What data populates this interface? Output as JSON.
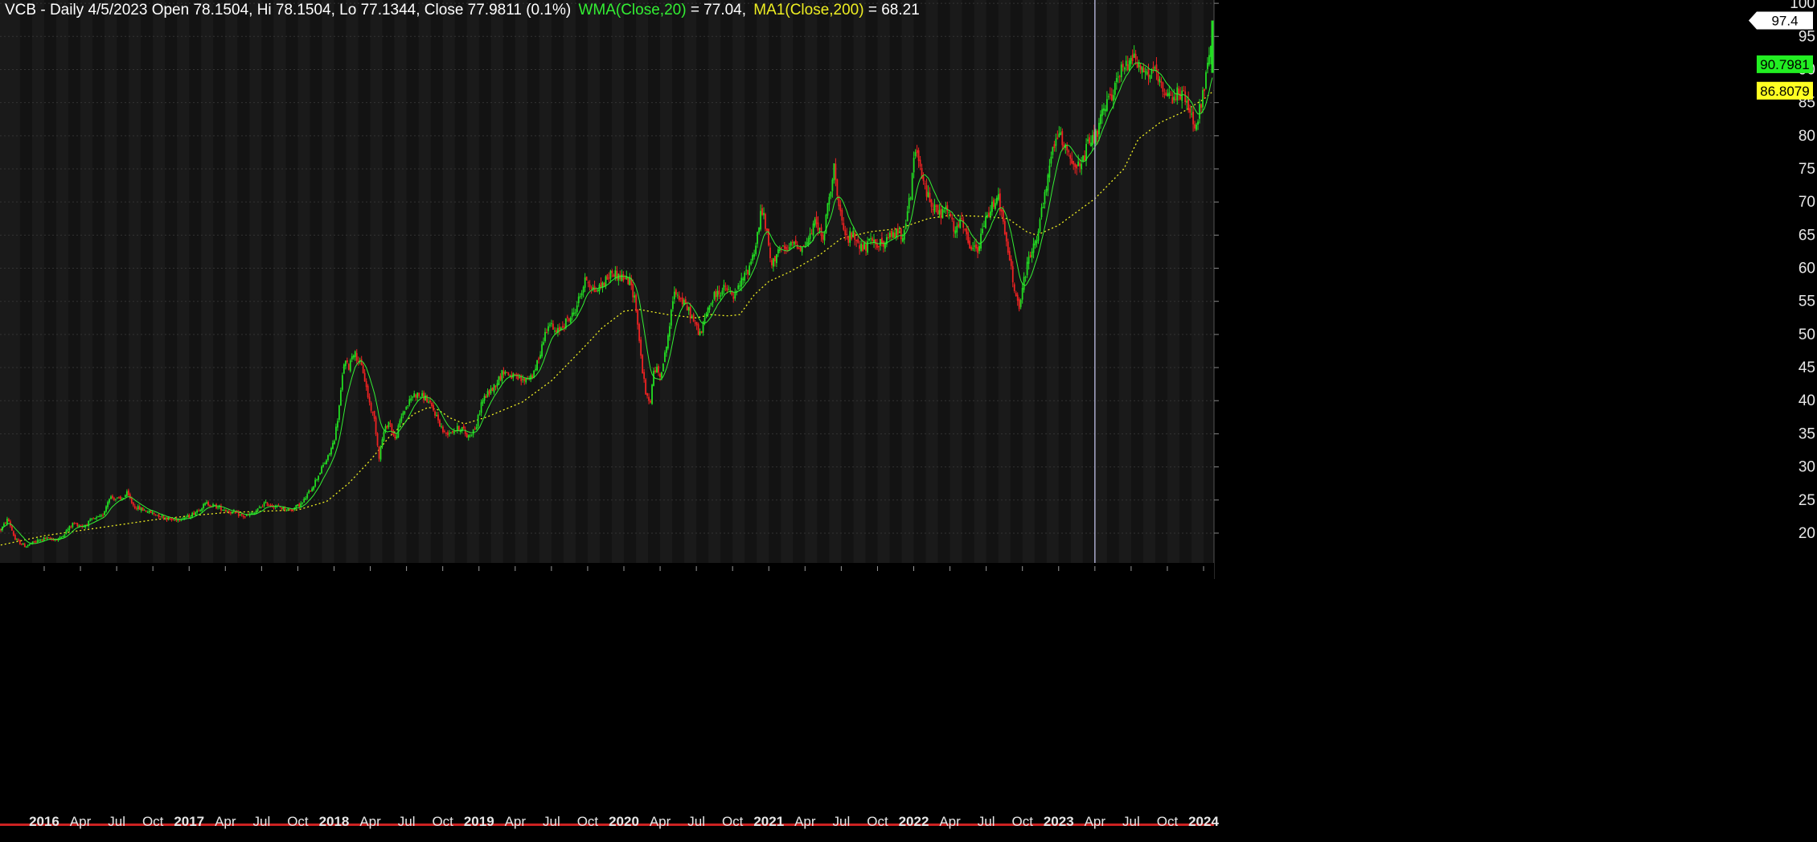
{
  "header": {
    "symbol_info": "VCB - Daily 4/5/2023 Open 78.1504, Hi 78.1504, Lo 77.1344, Close 77.9811 (0.1%)",
    "wma_label": "WMA(Close,20)",
    "wma_value": " = 77.04,",
    "ma_label": "MA1(Close,200)",
    "ma_value": " = 68.21"
  },
  "colors": {
    "background": "#1a1a1a",
    "band_alt": "#131313",
    "grid": "#333333",
    "up_candle": "#22dd22",
    "down_candle": "#ee2222",
    "wma_line": "#33ee33",
    "ma_line": "#eeee22",
    "cursor_line": "#aaaacc"
  },
  "chart_data": {
    "type": "line",
    "title": "VCB - Daily",
    "yticks": [
      20,
      25,
      30,
      35,
      40,
      45,
      50,
      55,
      60,
      65,
      70,
      75,
      80,
      85,
      90,
      95,
      100
    ],
    "ylim": [
      15.5,
      100.5
    ],
    "xticks": [
      {
        "label": "2016",
        "t": 2016.0,
        "year": true
      },
      {
        "label": "Apr",
        "t": 2016.25
      },
      {
        "label": "Jul",
        "t": 2016.5
      },
      {
        "label": "Oct",
        "t": 2016.75
      },
      {
        "label": "2017",
        "t": 2017.0,
        "year": true
      },
      {
        "label": "Apr",
        "t": 2017.25
      },
      {
        "label": "Jul",
        "t": 2017.5
      },
      {
        "label": "Oct",
        "t": 2017.75
      },
      {
        "label": "2018",
        "t": 2018.0,
        "year": true
      },
      {
        "label": "Apr",
        "t": 2018.25
      },
      {
        "label": "Jul",
        "t": 2018.5
      },
      {
        "label": "Oct",
        "t": 2018.75
      },
      {
        "label": "2019",
        "t": 2019.0,
        "year": true
      },
      {
        "label": "Apr",
        "t": 2019.25
      },
      {
        "label": "Jul",
        "t": 2019.5
      },
      {
        "label": "Oct",
        "t": 2019.75
      },
      {
        "label": "2020",
        "t": 2020.0,
        "year": true
      },
      {
        "label": "Apr",
        "t": 2020.25
      },
      {
        "label": "Jul",
        "t": 2020.5
      },
      {
        "label": "Oct",
        "t": 2020.75
      },
      {
        "label": "2021",
        "t": 2021.0,
        "year": true
      },
      {
        "label": "Apr",
        "t": 2021.25
      },
      {
        "label": "Jul",
        "t": 2021.5
      },
      {
        "label": "Oct",
        "t": 2021.75
      },
      {
        "label": "2022",
        "t": 2022.0,
        "year": true
      },
      {
        "label": "Apr",
        "t": 2022.25
      },
      {
        "label": "Jul",
        "t": 2022.5
      },
      {
        "label": "Oct",
        "t": 2022.75
      },
      {
        "label": "2023",
        "t": 2023.0,
        "year": true
      },
      {
        "label": "Apr",
        "t": 2023.25
      },
      {
        "label": "Jul",
        "t": 2023.5
      },
      {
        "label": "Oct",
        "t": 2023.75
      },
      {
        "label": "2024",
        "t": 2024.0,
        "year": true
      }
    ],
    "xrange": [
      2015.695,
      2024.072
    ],
    "price_path": [
      [
        2015.7,
        20.5
      ],
      [
        2015.75,
        22.2
      ],
      [
        2015.8,
        19.0
      ],
      [
        2015.87,
        18.0
      ],
      [
        2015.93,
        18.6
      ],
      [
        2016.0,
        19.2
      ],
      [
        2016.1,
        19.0
      ],
      [
        2016.2,
        21.5
      ],
      [
        2016.27,
        21.0
      ],
      [
        2016.33,
        22.0
      ],
      [
        2016.4,
        22.5
      ],
      [
        2016.45,
        25.5
      ],
      [
        2016.53,
        25.0
      ],
      [
        2016.57,
        26.0
      ],
      [
        2016.62,
        24.0
      ],
      [
        2016.75,
        23.0
      ],
      [
        2016.88,
        22.0
      ],
      [
        2017.0,
        22.5
      ],
      [
        2017.12,
        24.5
      ],
      [
        2017.25,
        23.5
      ],
      [
        2017.38,
        22.5
      ],
      [
        2017.45,
        23.0
      ],
      [
        2017.52,
        24.5
      ],
      [
        2017.6,
        24.0
      ],
      [
        2017.7,
        23.5
      ],
      [
        2017.78,
        24.5
      ],
      [
        2017.85,
        27.0
      ],
      [
        2017.92,
        30.0
      ],
      [
        2017.96,
        31.5
      ],
      [
        2018.0,
        34.0
      ],
      [
        2018.03,
        38.0
      ],
      [
        2018.07,
        46.0
      ],
      [
        2018.1,
        45.0
      ],
      [
        2018.13,
        47.5
      ],
      [
        2018.16,
        46.5
      ],
      [
        2018.2,
        44.5
      ],
      [
        2018.24,
        40.0
      ],
      [
        2018.28,
        37.0
      ],
      [
        2018.31,
        31.5
      ],
      [
        2018.34,
        35.0
      ],
      [
        2018.38,
        37.0
      ],
      [
        2018.42,
        34.0
      ],
      [
        2018.47,
        38.0
      ],
      [
        2018.55,
        41.0
      ],
      [
        2018.63,
        40.5
      ],
      [
        2018.7,
        38.0
      ],
      [
        2018.76,
        35.0
      ],
      [
        2018.82,
        35.5
      ],
      [
        2018.88,
        36.0
      ],
      [
        2018.92,
        34.5
      ],
      [
        2018.98,
        36.0
      ],
      [
        2019.02,
        40.0
      ],
      [
        2019.1,
        42.0
      ],
      [
        2019.17,
        44.5
      ],
      [
        2019.24,
        43.5
      ],
      [
        2019.3,
        43.0
      ],
      [
        2019.38,
        44.0
      ],
      [
        2019.43,
        48.0
      ],
      [
        2019.48,
        52.0
      ],
      [
        2019.53,
        50.0
      ],
      [
        2019.58,
        51.5
      ],
      [
        2019.65,
        53.0
      ],
      [
        2019.7,
        56.0
      ],
      [
        2019.74,
        58.5
      ],
      [
        2019.8,
        56.5
      ],
      [
        2019.85,
        57.5
      ],
      [
        2019.92,
        59.5
      ],
      [
        2019.95,
        59.0
      ],
      [
        2020.0,
        58.5
      ],
      [
        2020.04,
        58.0
      ],
      [
        2020.08,
        55.0
      ],
      [
        2020.12,
        46.0
      ],
      [
        2020.15,
        41.0
      ],
      [
        2020.18,
        39.5
      ],
      [
        2020.21,
        45.0
      ],
      [
        2020.25,
        44.0
      ],
      [
        2020.28,
        46.5
      ],
      [
        2020.32,
        52.0
      ],
      [
        2020.35,
        57.0
      ],
      [
        2020.4,
        55.0
      ],
      [
        2020.45,
        53.5
      ],
      [
        2020.5,
        51.0
      ],
      [
        2020.53,
        50.0
      ],
      [
        2020.58,
        54.0
      ],
      [
        2020.63,
        56.0
      ],
      [
        2020.7,
        57.0
      ],
      [
        2020.76,
        55.5
      ],
      [
        2020.8,
        57.5
      ],
      [
        2020.86,
        60.0
      ],
      [
        2020.91,
        63.5
      ],
      [
        2020.95,
        69.0
      ],
      [
        2020.98,
        66.0
      ],
      [
        2021.02,
        60.0
      ],
      [
        2021.06,
        63.0
      ],
      [
        2021.12,
        62.5
      ],
      [
        2021.18,
        64.0
      ],
      [
        2021.23,
        63.0
      ],
      [
        2021.28,
        64.5
      ],
      [
        2021.33,
        67.5
      ],
      [
        2021.37,
        63.5
      ],
      [
        2021.41,
        70.0
      ],
      [
        2021.45,
        75.5
      ],
      [
        2021.48,
        69.0
      ],
      [
        2021.53,
        64.5
      ],
      [
        2021.58,
        65.0
      ],
      [
        2021.65,
        63.0
      ],
      [
        2021.72,
        64.0
      ],
      [
        2021.8,
        63.5
      ],
      [
        2021.86,
        65.5
      ],
      [
        2021.92,
        65.0
      ],
      [
        2021.98,
        71.0
      ],
      [
        2022.01,
        78.5
      ],
      [
        2022.04,
        75.0
      ],
      [
        2022.08,
        72.0
      ],
      [
        2022.12,
        70.0
      ],
      [
        2022.18,
        68.0
      ],
      [
        2022.23,
        69.0
      ],
      [
        2022.28,
        65.5
      ],
      [
        2022.33,
        67.0
      ],
      [
        2022.38,
        63.5
      ],
      [
        2022.44,
        62.5
      ],
      [
        2022.49,
        67.0
      ],
      [
        2022.54,
        69.5
      ],
      [
        2022.58,
        71.5
      ],
      [
        2022.62,
        66.0
      ],
      [
        2022.66,
        61.5
      ],
      [
        2022.7,
        56.0
      ],
      [
        2022.73,
        54.0
      ],
      [
        2022.76,
        58.0
      ],
      [
        2022.8,
        62.0
      ],
      [
        2022.84,
        64.0
      ],
      [
        2022.87,
        67.0
      ],
      [
        2022.92,
        72.5
      ],
      [
        2022.95,
        77.0
      ],
      [
        2022.98,
        80.0
      ],
      [
        2023.02,
        79.5
      ],
      [
        2023.06,
        78.0
      ],
      [
        2023.1,
        76.0
      ],
      [
        2023.15,
        75.0
      ],
      [
        2023.2,
        78.5
      ],
      [
        2023.26,
        80.0
      ],
      [
        2023.3,
        83.0
      ],
      [
        2023.36,
        86.0
      ],
      [
        2023.42,
        89.5
      ],
      [
        2023.48,
        91.0
      ],
      [
        2023.52,
        93.0
      ],
      [
        2023.56,
        90.0
      ],
      [
        2023.62,
        89.5
      ],
      [
        2023.68,
        89.0
      ],
      [
        2023.72,
        86.0
      ],
      [
        2023.78,
        85.5
      ],
      [
        2023.83,
        87.0
      ],
      [
        2023.88,
        85.0
      ],
      [
        2023.93,
        82.0
      ],
      [
        2023.96,
        82.5
      ],
      [
        2024.0,
        87.0
      ],
      [
        2024.03,
        90.5
      ],
      [
        2024.05,
        93.0
      ],
      [
        2024.07,
        90.8
      ]
    ],
    "wma_label": "WMA(Close,20)",
    "ma_label": "MA1(Close,200)",
    "ma_path": [
      [
        2015.7,
        18.2
      ],
      [
        2016.0,
        19.6
      ],
      [
        2016.5,
        21.2
      ],
      [
        2016.75,
        22.0
      ],
      [
        2017.0,
        22.6
      ],
      [
        2017.25,
        23.1
      ],
      [
        2017.5,
        23.3
      ],
      [
        2017.75,
        23.5
      ],
      [
        2017.95,
        24.8
      ],
      [
        2018.1,
        27.5
      ],
      [
        2018.25,
        31.0
      ],
      [
        2018.38,
        34.5
      ],
      [
        2018.55,
        38.0
      ],
      [
        2018.65,
        39.0
      ],
      [
        2018.72,
        38.6
      ],
      [
        2018.8,
        37.4
      ],
      [
        2018.9,
        36.5
      ],
      [
        2019.05,
        37.5
      ],
      [
        2019.3,
        39.8
      ],
      [
        2019.5,
        43.0
      ],
      [
        2019.7,
        47.5
      ],
      [
        2019.85,
        51.0
      ],
      [
        2020.0,
        53.5
      ],
      [
        2020.1,
        53.8
      ],
      [
        2020.3,
        53.0
      ],
      [
        2020.5,
        52.5
      ],
      [
        2020.6,
        53.0
      ],
      [
        2020.72,
        52.8
      ],
      [
        2020.8,
        53.0
      ],
      [
        2020.9,
        56.0
      ],
      [
        2021.0,
        58.0
      ],
      [
        2021.15,
        59.5
      ],
      [
        2021.35,
        62.0
      ],
      [
        2021.5,
        64.5
      ],
      [
        2021.7,
        65.5
      ],
      [
        2021.9,
        66.0
      ],
      [
        2022.1,
        67.5
      ],
      [
        2022.25,
        68.0
      ],
      [
        2022.5,
        67.8
      ],
      [
        2022.65,
        67.5
      ],
      [
        2022.78,
        65.5
      ],
      [
        2022.85,
        65.0
      ],
      [
        2023.0,
        66.5
      ],
      [
        2023.25,
        70.5
      ],
      [
        2023.45,
        75.0
      ],
      [
        2023.55,
        79.5
      ],
      [
        2023.7,
        82.0
      ],
      [
        2023.85,
        83.5
      ],
      [
        2024.0,
        85.5
      ],
      [
        2024.07,
        86.8
      ]
    ],
    "last_price": 97.4,
    "price_tags": [
      {
        "label": "97.4",
        "value": 97.4,
        "style": "white"
      },
      {
        "label": "90.7981",
        "value": 90.7981,
        "style": "green"
      },
      {
        "label": "86.8079",
        "value": 86.8079,
        "style": "yellow"
      }
    ],
    "cursor_t": 2023.25,
    "grid": true
  }
}
